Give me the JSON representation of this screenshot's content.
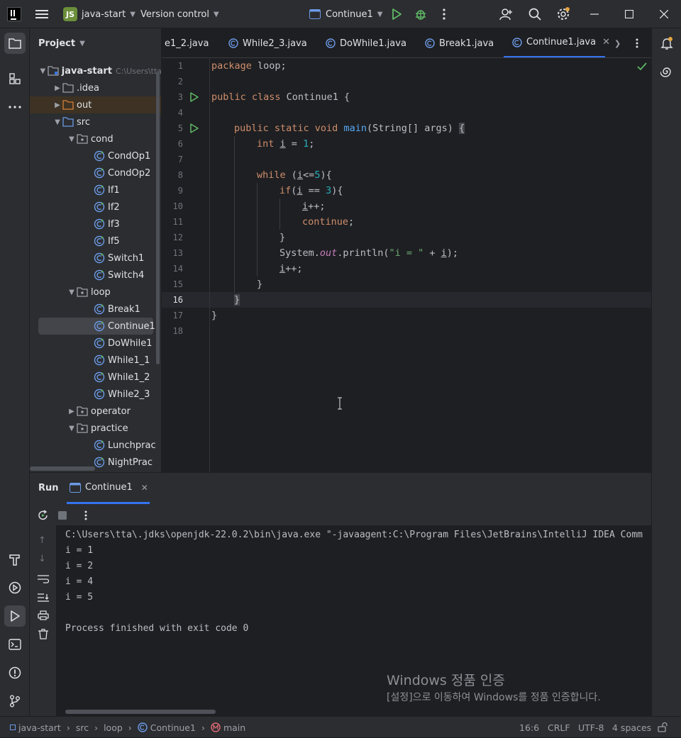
{
  "titlebar": {
    "project_badge": "JS",
    "project_name": "java-start",
    "vcs": "Version control",
    "run_config": "Continue1"
  },
  "project_panel": {
    "title": "Project",
    "root_name": "java-start",
    "root_path": "C:\\Users\\tta",
    "items": [
      {
        "label": ".idea"
      },
      {
        "label": "out"
      },
      {
        "label": "src"
      },
      {
        "label": "cond"
      },
      {
        "label": "CondOp1"
      },
      {
        "label": "CondOp2"
      },
      {
        "label": "If1"
      },
      {
        "label": "If2"
      },
      {
        "label": "If3"
      },
      {
        "label": "If5"
      },
      {
        "label": "Switch1"
      },
      {
        "label": "Switch4"
      },
      {
        "label": "loop"
      },
      {
        "label": "Break1"
      },
      {
        "label": "Continue1"
      },
      {
        "label": "DoWhile1"
      },
      {
        "label": "While1_1"
      },
      {
        "label": "While1_2"
      },
      {
        "label": "While2_3"
      },
      {
        "label": "operator"
      },
      {
        "label": "practice"
      },
      {
        "label": "Lunchprac"
      },
      {
        "label": "NightPrac"
      }
    ]
  },
  "tabs": [
    {
      "label": "e1_2.java"
    },
    {
      "label": "While2_3.java"
    },
    {
      "label": "DoWhile1.java"
    },
    {
      "label": "Break1.java"
    },
    {
      "label": "Continue1.java"
    }
  ],
  "editor": {
    "line_numbers": [
      "1",
      "2",
      "3",
      "4",
      "5",
      "6",
      "7",
      "8",
      "9",
      "10",
      "11",
      "12",
      "13",
      "14",
      "15",
      "16",
      "17",
      "18"
    ],
    "current_line": "16",
    "code": {
      "l1_kw": "package",
      "l1_rest": " loop;",
      "l3_kw": "public class",
      "l3_rest": " Continue1 {",
      "l5_kw": "public static void",
      "l5_fn": "main",
      "l5_rest": "(String[] args) ",
      "l5_brace": "{",
      "l6_kw": "int",
      "l6_var": "i",
      "l6_eq": " = ",
      "l6_num": "1",
      "l6_end": ";",
      "l8_kw": "while",
      "l8_a": " (",
      "l8_var": "i",
      "l8_b": "<=",
      "l8_num": "5",
      "l8_c": "){",
      "l9_kw": "if",
      "l9_a": "(",
      "l9_var": "i",
      "l9_b": " == ",
      "l9_num": "3",
      "l9_c": "){",
      "l10_var": "i",
      "l10_rest": "++;",
      "l11_kw": "continue",
      "l11_end": ";",
      "l12": "}",
      "l13_a": "System.",
      "l13_out": "out",
      "l13_b": ".println(",
      "l13_str": "\"i = \"",
      "l13_c": " + ",
      "l13_var": "i",
      "l13_d": ");",
      "l14_var": "i",
      "l14_rest": "++;",
      "l15": "}",
      "l16": "}",
      "l17": "}"
    }
  },
  "run_panel": {
    "title": "Run",
    "tab_label": "Continue1",
    "console_lines": [
      "C:\\Users\\tta\\.jdks\\openjdk-22.0.2\\bin\\java.exe \"-javaagent:C:\\Program Files\\JetBrains\\IntelliJ IDEA Comm",
      "i = 1",
      "i = 2",
      "i = 4",
      "i = 5",
      "",
      "Process finished with exit code 0"
    ],
    "watermark_title": "Windows 정품 인증",
    "watermark_sub": "[설정]으로 이동하여 Windows를 정품 인증합니다."
  },
  "statusbar": {
    "crumb_project": "java-start",
    "crumb_src": "src",
    "crumb_pkg": "loop",
    "crumb_class": "Continue1",
    "crumb_method": "main",
    "position": "16:6",
    "line_sep": "CRLF",
    "encoding": "UTF-8",
    "indent": "4 spaces"
  },
  "colors": {
    "accent": "#3574f0",
    "run_green": "#5fb865",
    "keyword": "#cf8e6d",
    "string": "#6aab73",
    "number": "#2aacb8"
  }
}
